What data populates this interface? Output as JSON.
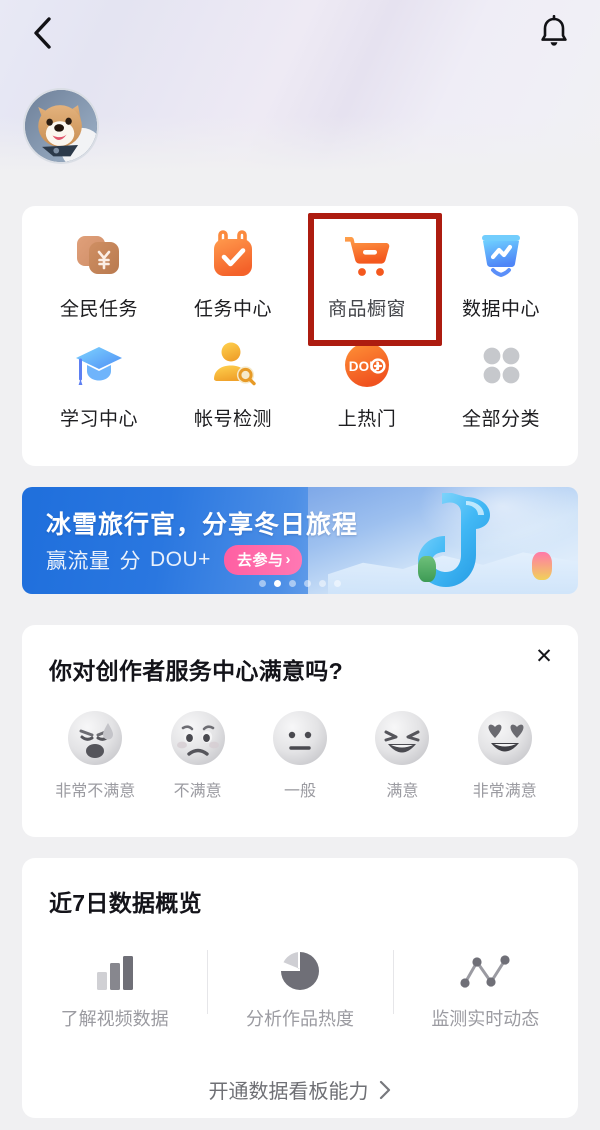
{
  "header": {
    "back_icon": "chevron-left-icon",
    "bell_icon": "bell-icon",
    "avatar_alt": "dog-avatar"
  },
  "grid": {
    "items": [
      {
        "label": "全民任务",
        "icon": "stacked-cards-yen-icon"
      },
      {
        "label": "任务中心",
        "icon": "calendar-check-icon"
      },
      {
        "label": "商品橱窗",
        "icon": "shopping-cart-icon"
      },
      {
        "label": "数据中心",
        "icon": "chart-board-icon"
      },
      {
        "label": "学习中心",
        "icon": "graduation-cap-icon"
      },
      {
        "label": "帐号检测",
        "icon": "user-search-icon"
      },
      {
        "label": "上热门",
        "icon": "douplus-icon"
      },
      {
        "label": "全部分类",
        "icon": "four-dots-grid-icon"
      }
    ],
    "highlight_label": "商品橱窗",
    "highlight_color": "#ad1c10"
  },
  "banner": {
    "title": "冰雪旅行官，分享冬日旅程",
    "subtitle_prefix": "赢流量",
    "subtitle_mid": "分",
    "subtitle_brand": "DOU+",
    "cta_label": "去参与",
    "cta_chevron": "›",
    "dots_total": 6,
    "dots_active_index": 1,
    "accent_color": "#ff5fa2"
  },
  "survey": {
    "title": "你对创作者服务中心满意吗?",
    "close_icon": "close-icon",
    "close_glyph": "✕",
    "options": [
      {
        "label": "非常不满意",
        "icon": "face-very-dissatisfied-icon"
      },
      {
        "label": "不满意",
        "icon": "face-dissatisfied-icon"
      },
      {
        "label": "一般",
        "icon": "face-neutral-icon"
      },
      {
        "label": "满意",
        "icon": "face-satisfied-icon"
      },
      {
        "label": "非常满意",
        "icon": "face-very-satisfied-icon"
      }
    ]
  },
  "data_overview": {
    "title": "近7日数据概览",
    "features": [
      {
        "label": "了解视频数据",
        "icon": "bar-chart-icon"
      },
      {
        "label": "分析作品热度",
        "icon": "pie-chart-icon"
      },
      {
        "label": "监测实时动态",
        "icon": "line-chart-icon"
      }
    ],
    "cta_label": "开通数据看板能力",
    "cta_chevron": "›"
  }
}
